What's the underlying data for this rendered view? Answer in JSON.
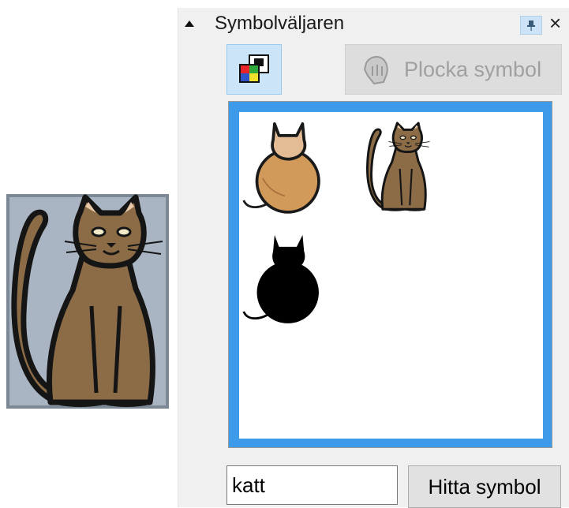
{
  "panel": {
    "title": "Symbolväljaren",
    "pin_icon": "pin-icon",
    "close_label": "×"
  },
  "toolbar": {
    "palette_icon": "color-palette-icon",
    "pick_symbol_label": "Plocka symbol",
    "pick_symbol_icon": "hand-pointer-icon",
    "pick_symbol_enabled": false
  },
  "canvas": {
    "symbol_icon": "cat-brown-sitting-icon"
  },
  "results": {
    "items": [
      {
        "icon": "cat-round-beige-icon"
      },
      {
        "icon": "cat-brown-sitting-icon"
      },
      {
        "icon": "cat-black-silhouette-icon"
      }
    ],
    "frame_color": "#3d9be9"
  },
  "search": {
    "value": "katt",
    "button_label": "Hitta symbol"
  }
}
